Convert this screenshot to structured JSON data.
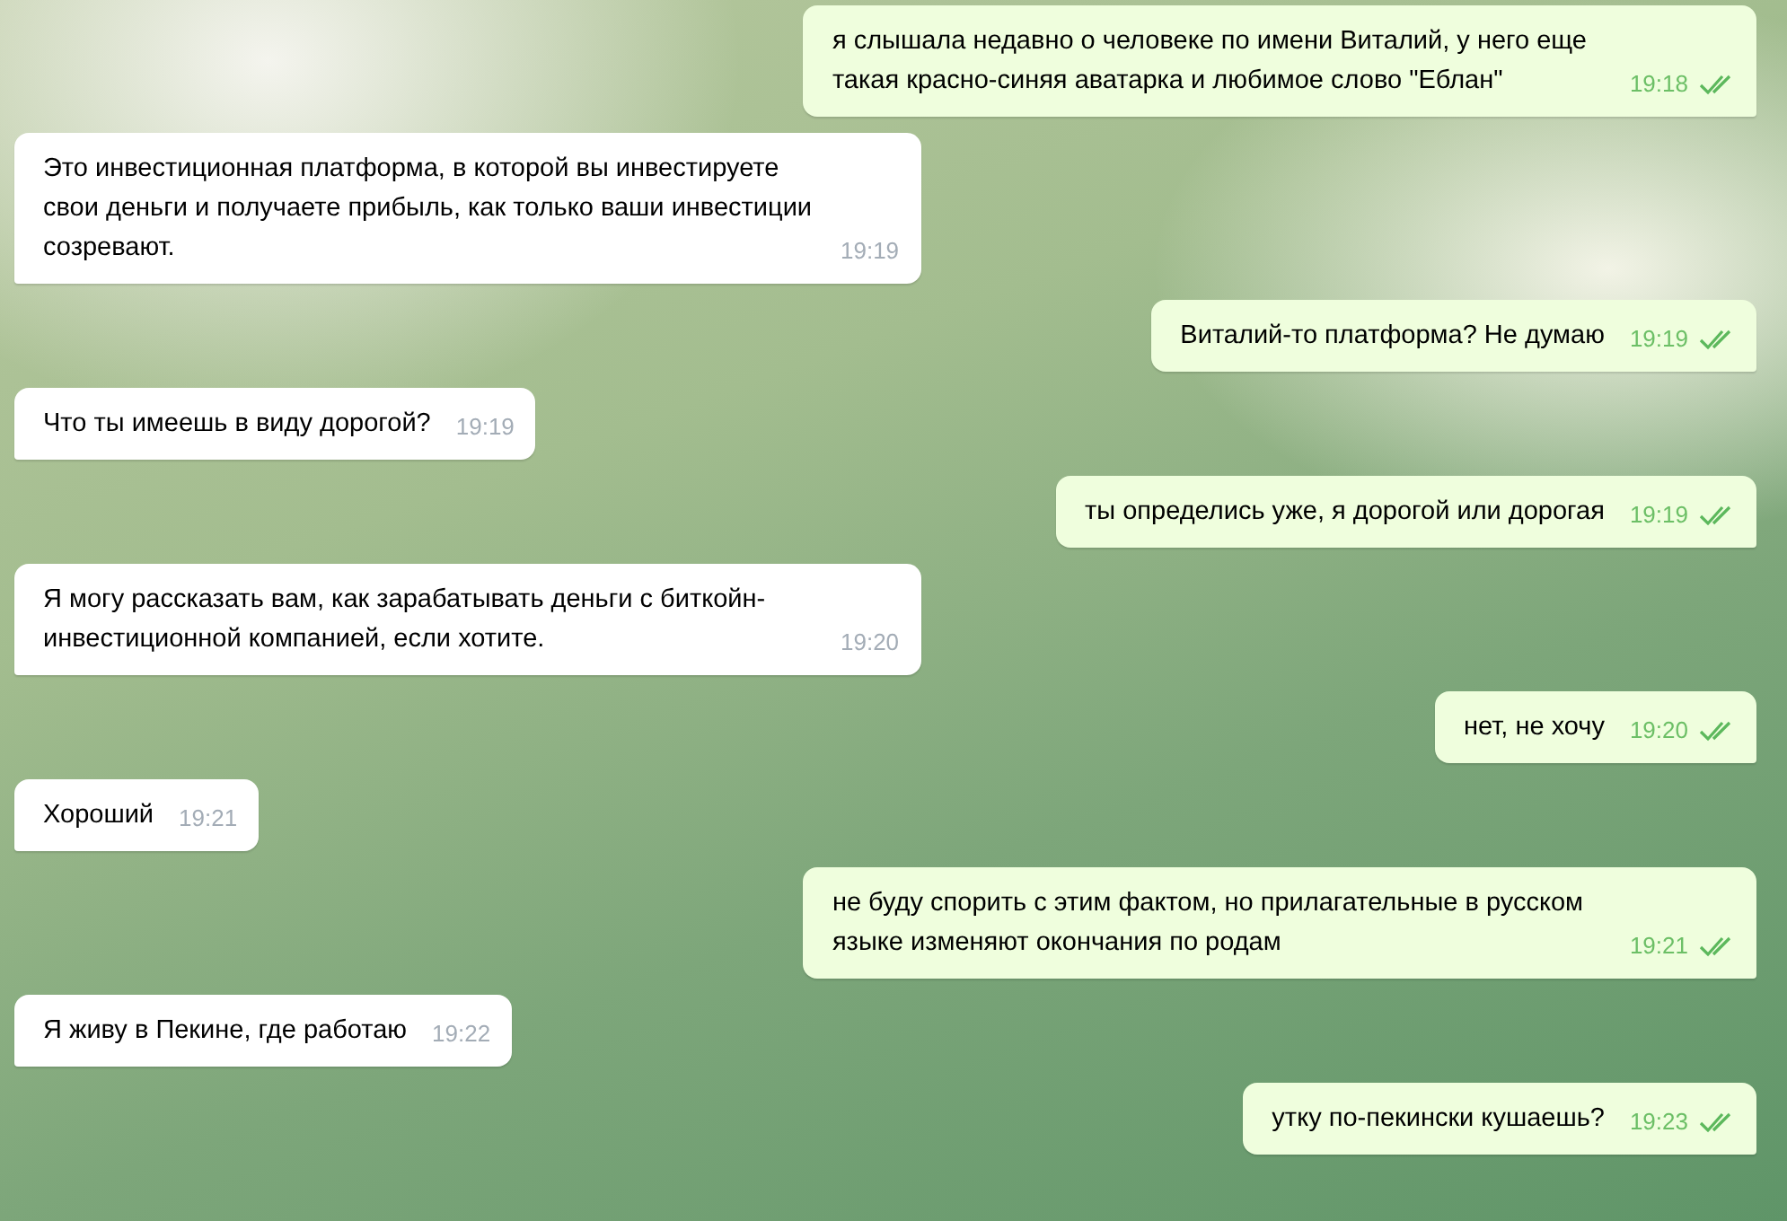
{
  "messages": [
    {
      "kind": "out",
      "text": "я слышала недавно о человеке по имени Виталий, у него еще такая красно-синяя аватарка и любимое слово \"Еблан\"",
      "time": "19:18",
      "read": true
    },
    {
      "kind": "in",
      "text": "Это инвестиционная платформа, в которой вы инвестируете свои деньги и получаете прибыль, как только ваши инвестиции созревают.",
      "time": "19:19"
    },
    {
      "kind": "out",
      "text": "Виталий-то платформа? Не думаю",
      "time": "19:19",
      "read": true
    },
    {
      "kind": "in",
      "text": "Что ты имеешь в виду дорогой?",
      "time": "19:19"
    },
    {
      "kind": "out",
      "text": "ты определись уже, я дорогой или дорогая",
      "time": "19:19",
      "read": true
    },
    {
      "kind": "in",
      "text": "Я могу рассказать вам, как зарабатывать деньги с биткойн-инвестиционной компанией, если хотите.",
      "time": "19:20"
    },
    {
      "kind": "out",
      "text": "нет, не хочу",
      "time": "19:20",
      "read": true
    },
    {
      "kind": "in",
      "text": "Хороший",
      "time": "19:21"
    },
    {
      "kind": "out",
      "text": "не буду спорить с этим фактом, но прилагательные в русском языке изменяют окончания по родам",
      "time": "19:21",
      "read": true
    },
    {
      "kind": "in",
      "text": "Я живу в Пекине, где работаю",
      "time": "19:22"
    },
    {
      "kind": "out",
      "text": "утку по-пекински кушаешь?",
      "time": "19:23",
      "read": true
    }
  ]
}
